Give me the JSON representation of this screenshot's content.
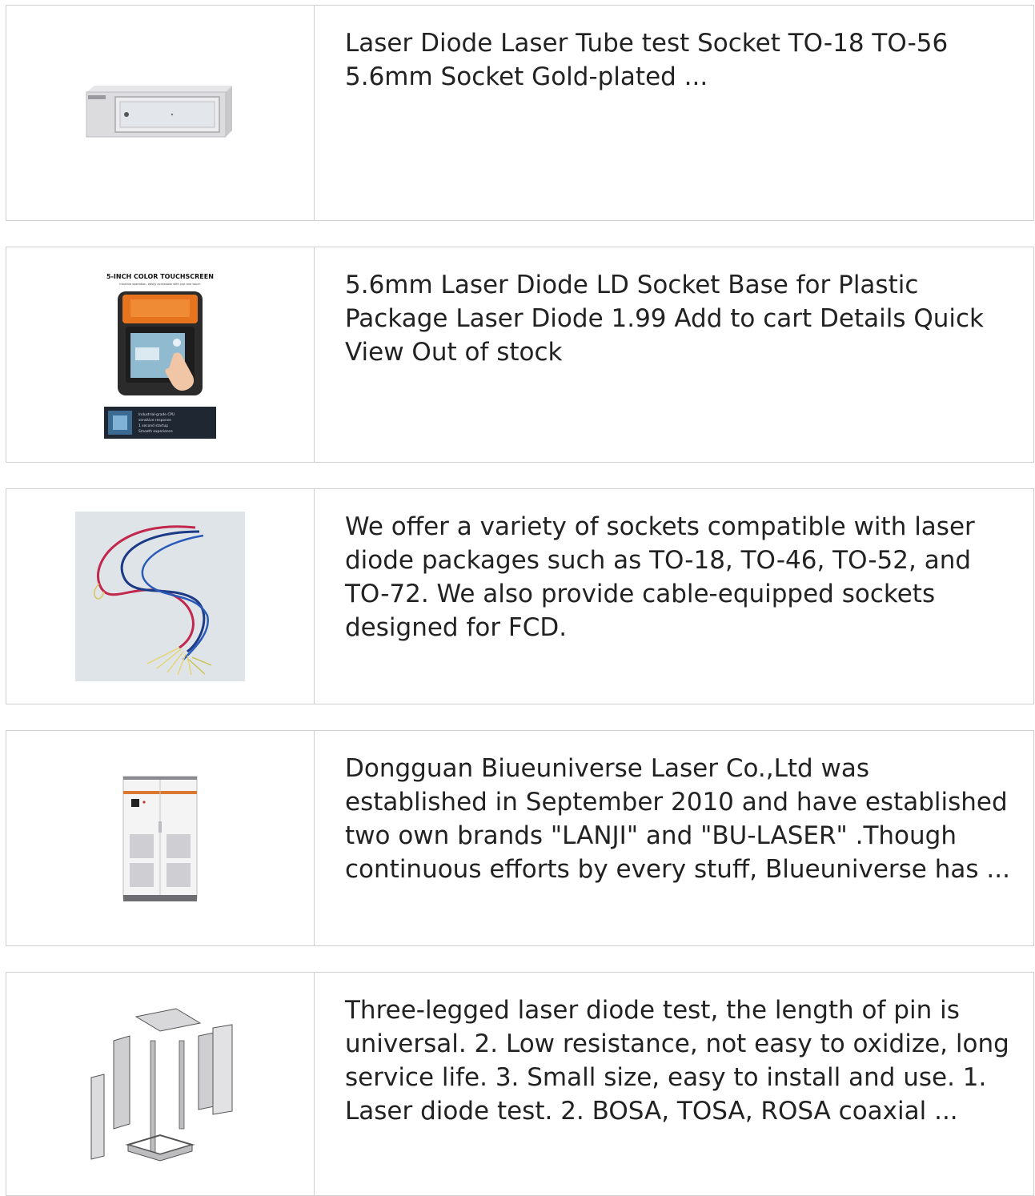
{
  "products": [
    {
      "image": "wall-mount-network-cabinet",
      "description": "Laser Diode Laser Tube test Socket TO-18 TO-56 5.6mm Socket Gold-plated ..."
    },
    {
      "image": "fusion-splicer-touchscreen",
      "image_title": "5-INCH COLOR TOUCHSCREEN",
      "image_subtitle": "Intuitive operation, easily accessible with just one touch",
      "image_features": [
        "Industrial-grade CPU",
        "sensitive response",
        "1 second startup",
        "Smooth experience"
      ],
      "description": "5.6mm Laser Diode LD Socket Base for Plastic Package Laser Diode 1.99 Add to cart Details Quick View Out of stock"
    },
    {
      "image": "fiber-optic-cables",
      "description": "We offer a variety of sockets compatible with laser diode packages such as TO-18, TO-46, TO-52, and TO-72. We also provide cable-equipped sockets designed for FCD."
    },
    {
      "image": "floor-standing-power-cabinet",
      "description": "Dongguan Biueuniverse Laser Co.,Ltd was established in September 2010 and have established two own brands \"LANJI\" and \"BU-LASER\" .Though continuous efforts by every stuff, Blueuniverse has ..."
    },
    {
      "image": "exploded-enclosure-cabinet",
      "description": "Three-legged laser diode test, the length of pin is universal. 2. Low resistance, not easy to oxidize, long service life. 3. Small size, easy to install and use. 1. Laser diode test. 2. BOSA, TOSA, ROSA coaxial ..."
    }
  ]
}
